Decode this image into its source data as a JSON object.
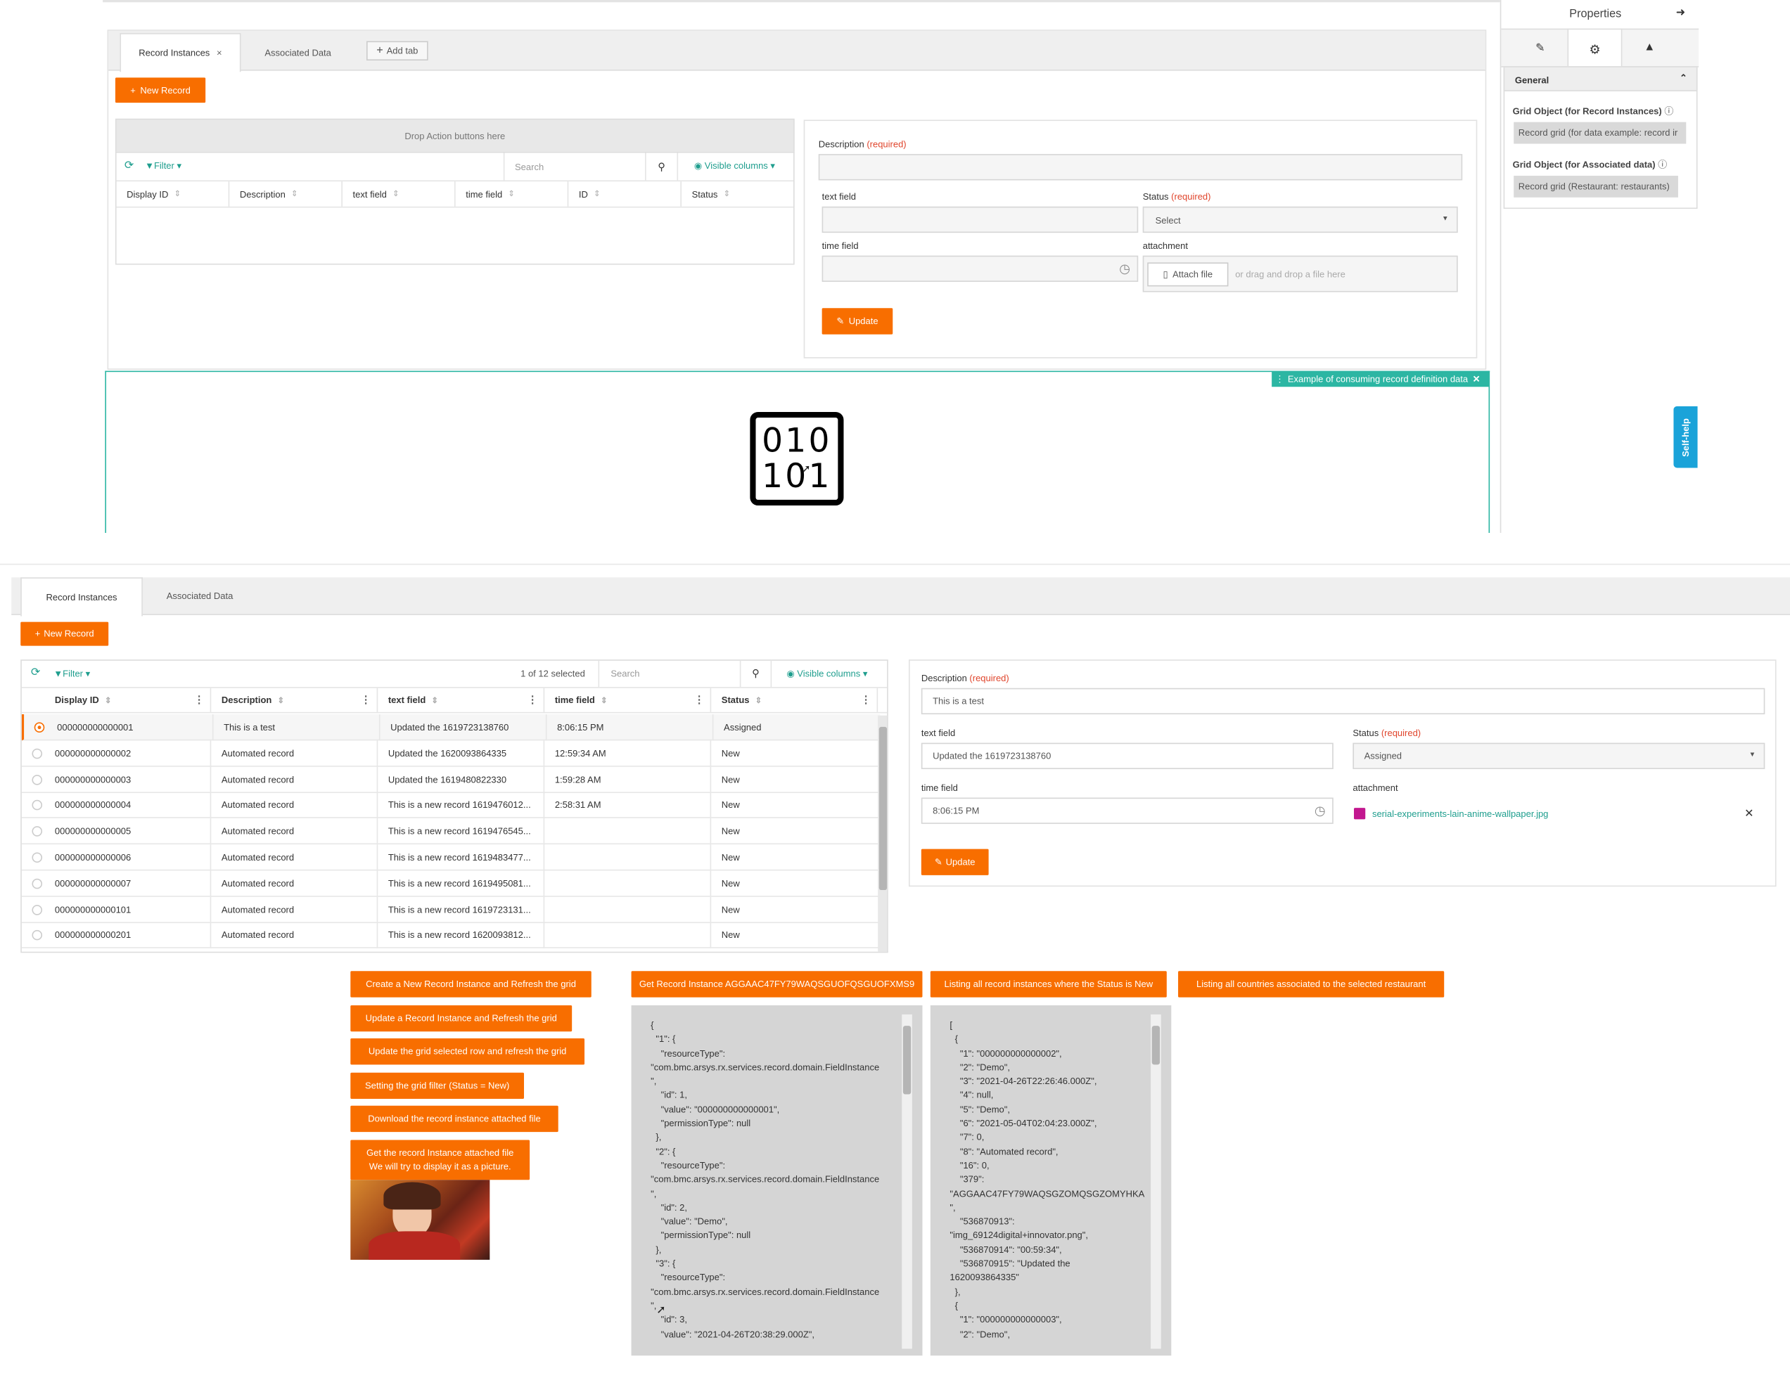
{
  "designer": {
    "tabs": [
      {
        "label": "Record Instances",
        "close": "×"
      },
      {
        "label": "Associated Data"
      },
      {
        "label": "Add tab"
      }
    ],
    "new_record_label": "New Record",
    "drop_zone_label": "Drop Action buttons here",
    "toolbar": {
      "filter_label": "Filter",
      "search_placeholder": "Search",
      "visible_columns_label": "Visible columns"
    },
    "columns": [
      "Display ID",
      "Description",
      "text field",
      "time field",
      "ID",
      "Status"
    ],
    "form": {
      "description_label": "Description",
      "required": "(required)",
      "text_field_label": "text field",
      "status_label": "Status",
      "status_select": "Select",
      "time_field_label": "time field",
      "attachment_label": "attachment",
      "attach_file_label": "Attach file",
      "drop_hint": "or drag and drop a file here",
      "update_label": "Update"
    },
    "component_badge": "Example of consuming record definition data",
    "component_glyph_top": "010",
    "component_glyph_bottom": "101"
  },
  "properties": {
    "title": "Properties",
    "section": "General",
    "grid_obj_record_label": "Grid Object (for Record Instances)",
    "grid_obj_record_value": "Record grid (for data example: record ir",
    "grid_obj_assoc_label": "Grid Object (for Associated data)",
    "grid_obj_assoc_value": "Record grid (Restaurant: restaurants)"
  },
  "self_help": "Self-help",
  "runtime": {
    "tabs": [
      "Record Instances",
      "Associated Data"
    ],
    "new_record_label": "New Record",
    "toolbar": {
      "filter_label": "Filter",
      "selected_count": "1 of 12 selected",
      "search_placeholder": "Search",
      "visible_columns_label": "Visible columns"
    },
    "columns": [
      "Display ID",
      "Description",
      "text field",
      "time field",
      "Status"
    ],
    "rows": [
      {
        "id": "000000000000001",
        "desc": "This is a test",
        "text": "Updated the 1619723138760",
        "time": "8:06:15 PM",
        "status": "Assigned",
        "selected": true
      },
      {
        "id": "000000000000002",
        "desc": "Automated record",
        "text": "Updated the 1620093864335",
        "time": "12:59:34 AM",
        "status": "New"
      },
      {
        "id": "000000000000003",
        "desc": "Automated record",
        "text": "Updated the 1619480822330",
        "time": "1:59:28 AM",
        "status": "New"
      },
      {
        "id": "000000000000004",
        "desc": "Automated record",
        "text": "This is a new record 1619476012...",
        "time": "2:58:31 AM",
        "status": "New"
      },
      {
        "id": "000000000000005",
        "desc": "Automated record",
        "text": "This is a new record 1619476545...",
        "time": "",
        "status": "New"
      },
      {
        "id": "000000000000006",
        "desc": "Automated record",
        "text": "This is a new record 1619483477...",
        "time": "",
        "status": "New"
      },
      {
        "id": "000000000000007",
        "desc": "Automated record",
        "text": "This is a new record 1619495081...",
        "time": "",
        "status": "New"
      },
      {
        "id": "000000000000101",
        "desc": "Automated record",
        "text": "This is a new record 1619723131...",
        "time": "",
        "status": "New"
      },
      {
        "id": "000000000000201",
        "desc": "Automated record",
        "text": "This is a new record 1620093812...",
        "time": "",
        "status": "New"
      }
    ],
    "form": {
      "description_label": "Description",
      "required": "(required)",
      "description_value": "This is a test",
      "text_field_label": "text field",
      "text_field_value": "Updated the 1619723138760",
      "status_label": "Status",
      "status_value": "Assigned",
      "time_field_label": "time field",
      "time_field_value": "8:06:15 PM",
      "attachment_label": "attachment",
      "attachment_file": "serial-experiments-lain-anime-wallpaper.jpg",
      "update_label": "Update"
    }
  },
  "actions": {
    "create": "Create a New Record Instance and Refresh the grid",
    "update": "Update a Record Instance and Refresh the grid",
    "update_selected": "Update the grid selected row and refresh the grid",
    "set_filter": "Setting the grid filter (Status = New)",
    "download": "Download the record instance attached file",
    "get_attached_1": "Get the record Instance attached file",
    "get_attached_2": "We will try to display it as a picture.",
    "get_instance": "Get Record Instance AGGAAC47FY79WAQSGUOFQSGUOFXMS9",
    "list_new": "Listing all record instances where the Status is New",
    "list_countries": "Listing all countries associated to the selected restaurant"
  },
  "json_left": "{\n  \"1\": {\n    \"resourceType\":\n\"com.bmc.arsys.rx.services.record.domain.FieldInstance\n\",\n    \"id\": 1,\n    \"value\": \"000000000000001\",\n    \"permissionType\": null\n  },\n  \"2\": {\n    \"resourceType\":\n\"com.bmc.arsys.rx.services.record.domain.FieldInstance\n\",\n    \"id\": 2,\n    \"value\": \"Demo\",\n    \"permissionType\": null\n  },\n  \"3\": {\n    \"resourceType\":\n\"com.bmc.arsys.rx.services.record.domain.FieldInstance\n\",\n    \"id\": 3,\n    \"value\": \"2021-04-26T20:38:29.000Z\",",
  "json_right": "[\n  {\n    \"1\": \"000000000000002\",\n    \"2\": \"Demo\",\n    \"3\": \"2021-04-26T22:26:46.000Z\",\n    \"4\": null,\n    \"5\": \"Demo\",\n    \"6\": \"2021-05-04T02:04:23.000Z\",\n    \"7\": 0,\n    \"8\": \"Automated record\",\n    \"16\": 0,\n    \"379\":\n\"AGGAAC47FY79WAQSGZOMQSGZOMYHKA\n\",\n    \"536870913\":\n\"img_69124digital+innovator.png\",\n    \"536870914\": \"00:59:34\",\n    \"536870915\": \"Updated the\n1620093864335\"\n  },\n  {\n    \"1\": \"000000000000003\",\n    \"2\": \"Demo\","
}
